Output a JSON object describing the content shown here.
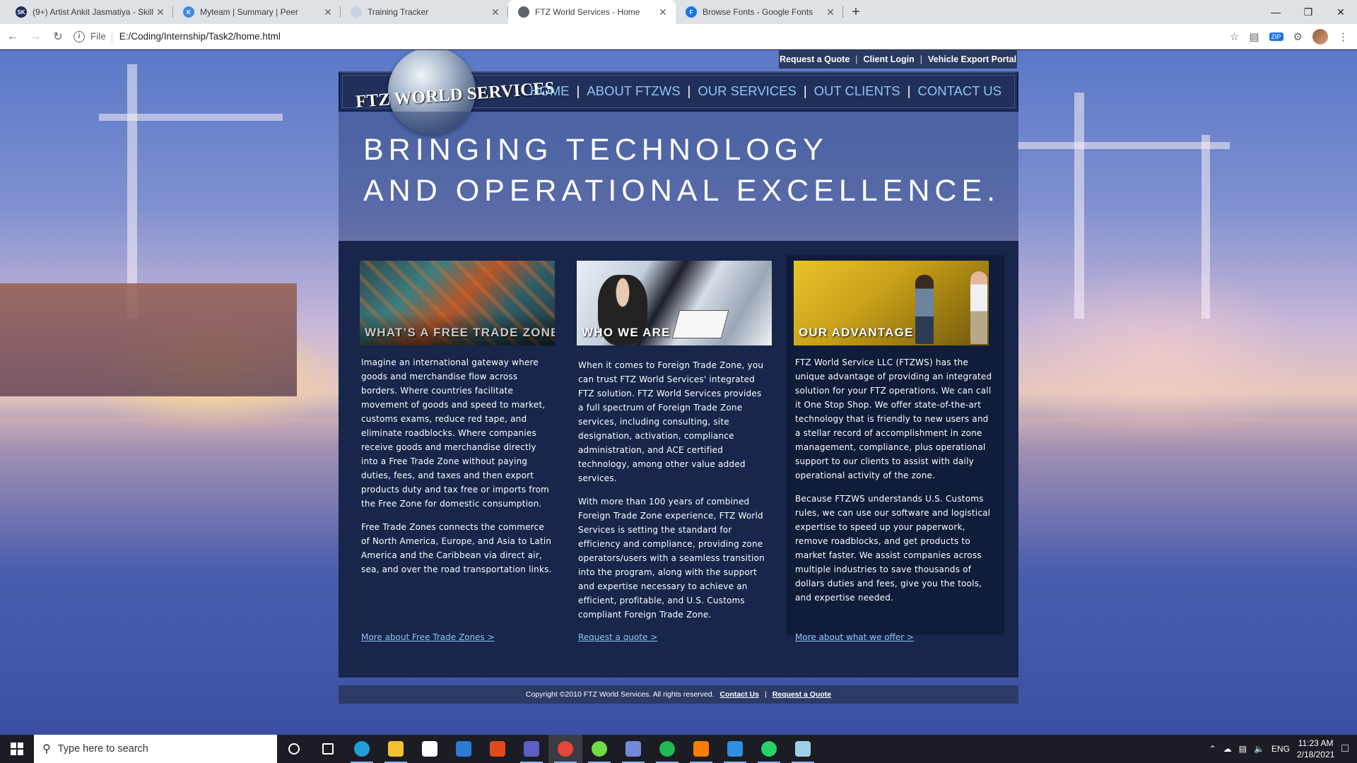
{
  "browser": {
    "tabs": [
      {
        "title": "(9+) Artist Ankit Jasmatiya - Skill",
        "icon": "skillshare-icon",
        "icon_text": "SK",
        "color": "#1f2d5a"
      },
      {
        "title": "Myteam | Summary | Peer",
        "icon": "myteam-icon",
        "icon_text": "K",
        "color": "#3b8ee0"
      },
      {
        "title": "Training Tracker",
        "icon": "document-icon",
        "icon_text": "",
        "color": "#c9d3e0"
      },
      {
        "title": "FTZ World Services - Home",
        "icon": "globe-icon",
        "icon_text": "",
        "color": "#5f6368"
      },
      {
        "title": "Browse Fonts - Google Fonts",
        "icon": "google-fonts-icon",
        "icon_text": "F",
        "color": "#1a73e8"
      }
    ],
    "active_tab": 3,
    "address_label": "File",
    "url": "E:/Coding/Internship/Task2/home.html"
  },
  "site": {
    "top_links": [
      "Request a Quote",
      "Client Login",
      "Vehicle Export Portal"
    ],
    "logo": "FTZ WORLD SERVICES",
    "nav": [
      "HOME",
      "ABOUT FTZWS",
      "OUR SERVICES",
      "OUT CLIENTS",
      "CONTACT US"
    ],
    "tagline_line1": "BRINGING TECHNOLOGY",
    "tagline_line2": "AND OPERATIONAL EXCELLENCE.",
    "columns": [
      {
        "caption": "WHAT’S A FREE TRADE ZONE?",
        "paragraphs": [
          "Imagine an international gateway where goods and merchandise flow across borders. Where countries facilitate movement of goods and speed to market, customs exams, reduce red tape, and eliminate roadblocks. Where companies receive goods and merchandise directly into a Free Trade Zone without paying duties, fees, and taxes and then export products duty and tax free or imports from the Free Zone for domestic consumption.",
          "Free Trade Zones connects the commerce of North America, Europe, and Asia to Latin America and the Caribbean via direct air, sea, and over the road transportation links."
        ],
        "link": "More about Free Trade Zones >"
      },
      {
        "caption": "WHO WE ARE",
        "paragraphs": [
          "When it comes to Foreign Trade Zone, you can trust FTZ World Services' integrated FTZ solution. FTZ World Services provides a full spectrum of Foreign Trade Zone services, including consulting, site designation, activation, compliance administration, and ACE certified technology, among other value added services.",
          "With more than 100 years of combined Foreign Trade Zone experience, FTZ World Services is setting the standard for efficiency and compliance, providing zone operators/users with a seamless transition into the program, along with the support and expertise necessary to achieve an efficient, profitable, and U.S. Customs compliant Foreign Trade Zone."
        ],
        "link": "Request a quote >"
      },
      {
        "caption": "OUR ADVANTAGE",
        "paragraphs": [
          "FTZ World Service LLC (FTZWS) has the unique advantage of providing an integrated solution for your FTZ operations. We can call it One Stop Shop. We offer state-of-the-art technology that is friendly to new users and a stellar record of accomplishment in zone management, compliance, plus operational support to our clients to assist with daily operational activity of the zone.",
          "Because FTZWS understands U.S. Customs rules, we can use our software and logistical expertise to speed up your paperwork, remove roadblocks, and get products to market faster. We assist companies across multiple industries to save thousands of dollars duties and fees, give you the tools, and expertise needed."
        ],
        "link": "More about what we offer >"
      }
    ],
    "footer_copyright": "Copyright ©2010 FTZ World Services. All rights reserved.",
    "footer_links": [
      "Contact Us",
      "Request a Quote"
    ]
  },
  "taskbar": {
    "search_placeholder": "Type here to search",
    "apps": [
      {
        "name": "cortana-icon",
        "color": "#ffffff"
      },
      {
        "name": "task-view-icon",
        "color": "#ffffff"
      },
      {
        "name": "edge-icon",
        "color": "#1fa0d8"
      },
      {
        "name": "file-explorer-icon",
        "color": "#f2c230"
      },
      {
        "name": "store-icon",
        "color": "#ffffff"
      },
      {
        "name": "mail-icon",
        "color": "#2a7bd3"
      },
      {
        "name": "office-icon",
        "color": "#e24a1c"
      },
      {
        "name": "teams-icon",
        "color": "#5b5fc7"
      },
      {
        "name": "chrome-icon",
        "color": "#e8453c"
      },
      {
        "name": "upwork-icon",
        "color": "#6fda44"
      },
      {
        "name": "discord-icon",
        "color": "#7289da"
      },
      {
        "name": "spotify-icon",
        "color": "#1db954"
      },
      {
        "name": "illustrator-icon",
        "color": "#ff7c00"
      },
      {
        "name": "vscode-icon",
        "color": "#2f8fe0"
      },
      {
        "name": "whatsapp-icon",
        "color": "#25d366"
      },
      {
        "name": "notes-icon",
        "color": "#9fd0e8"
      }
    ],
    "language": "ENG",
    "time": "11:23 AM",
    "date": "2/18/2021"
  }
}
